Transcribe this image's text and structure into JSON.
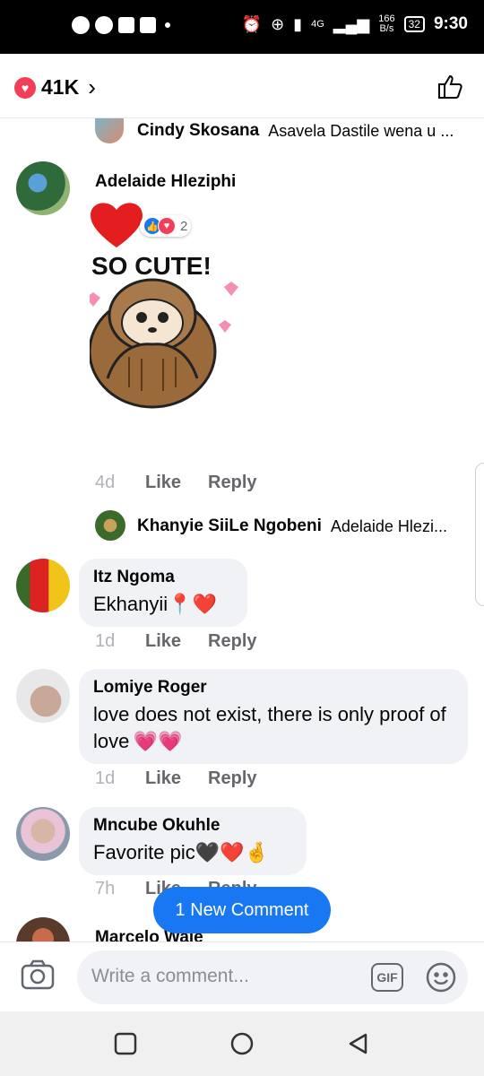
{
  "status": {
    "net_speed_value": "166",
    "net_speed_unit": "B/s",
    "battery": "32",
    "time": "9:30",
    "net_type": "4G"
  },
  "header": {
    "reaction_count": "41K"
  },
  "comments": [
    {
      "type": "reply",
      "author": "Cindy Skosana",
      "snippet": "Asavela Dastile wena u ..."
    },
    {
      "type": "sticker",
      "author": "Adelaide Hleziphi",
      "sticker_text": "SO CUTE!",
      "reaction_count": "2",
      "timestamp": "4d",
      "like": "Like",
      "reply": "Reply"
    },
    {
      "type": "reply",
      "author": "Khanyie SiiLe Ngobeni",
      "snippet": "Adelaide Hlezi..."
    },
    {
      "type": "comment",
      "author": "Itz Ngoma",
      "text": "Ekhanyii",
      "emoji": "📍❤️",
      "timestamp": "1d",
      "like": "Like",
      "reply": "Reply"
    },
    {
      "type": "comment",
      "author": "Lomiye Roger",
      "text": "love does not exist, there is only proof of love",
      "emoji": "💗💗",
      "timestamp": "1d",
      "like": "Like",
      "reply": "Reply"
    },
    {
      "type": "comment",
      "author": "Mncube Okuhle",
      "text": "Favorite pic",
      "emoji": "🖤❤️🤞",
      "timestamp": "7h",
      "like": "Like",
      "reply": "Reply"
    },
    {
      "type": "comment",
      "author": "Marcelo Wale"
    }
  ],
  "new_comment_label": "1 New Comment",
  "composer": {
    "placeholder": "Write a comment...",
    "gif_label": "GIF"
  },
  "colors": {
    "accent": "#1877f2",
    "love": "#f33e58",
    "bubble": "#f0f2f5"
  },
  "icons": [
    "messenger-icon",
    "whatsapp-icon",
    "alarm-icon",
    "signal-icon",
    "battery-icon",
    "like-icon",
    "camera-icon",
    "gif-icon",
    "emoji-icon",
    "recent-apps-icon",
    "home-icon",
    "back-icon"
  ]
}
